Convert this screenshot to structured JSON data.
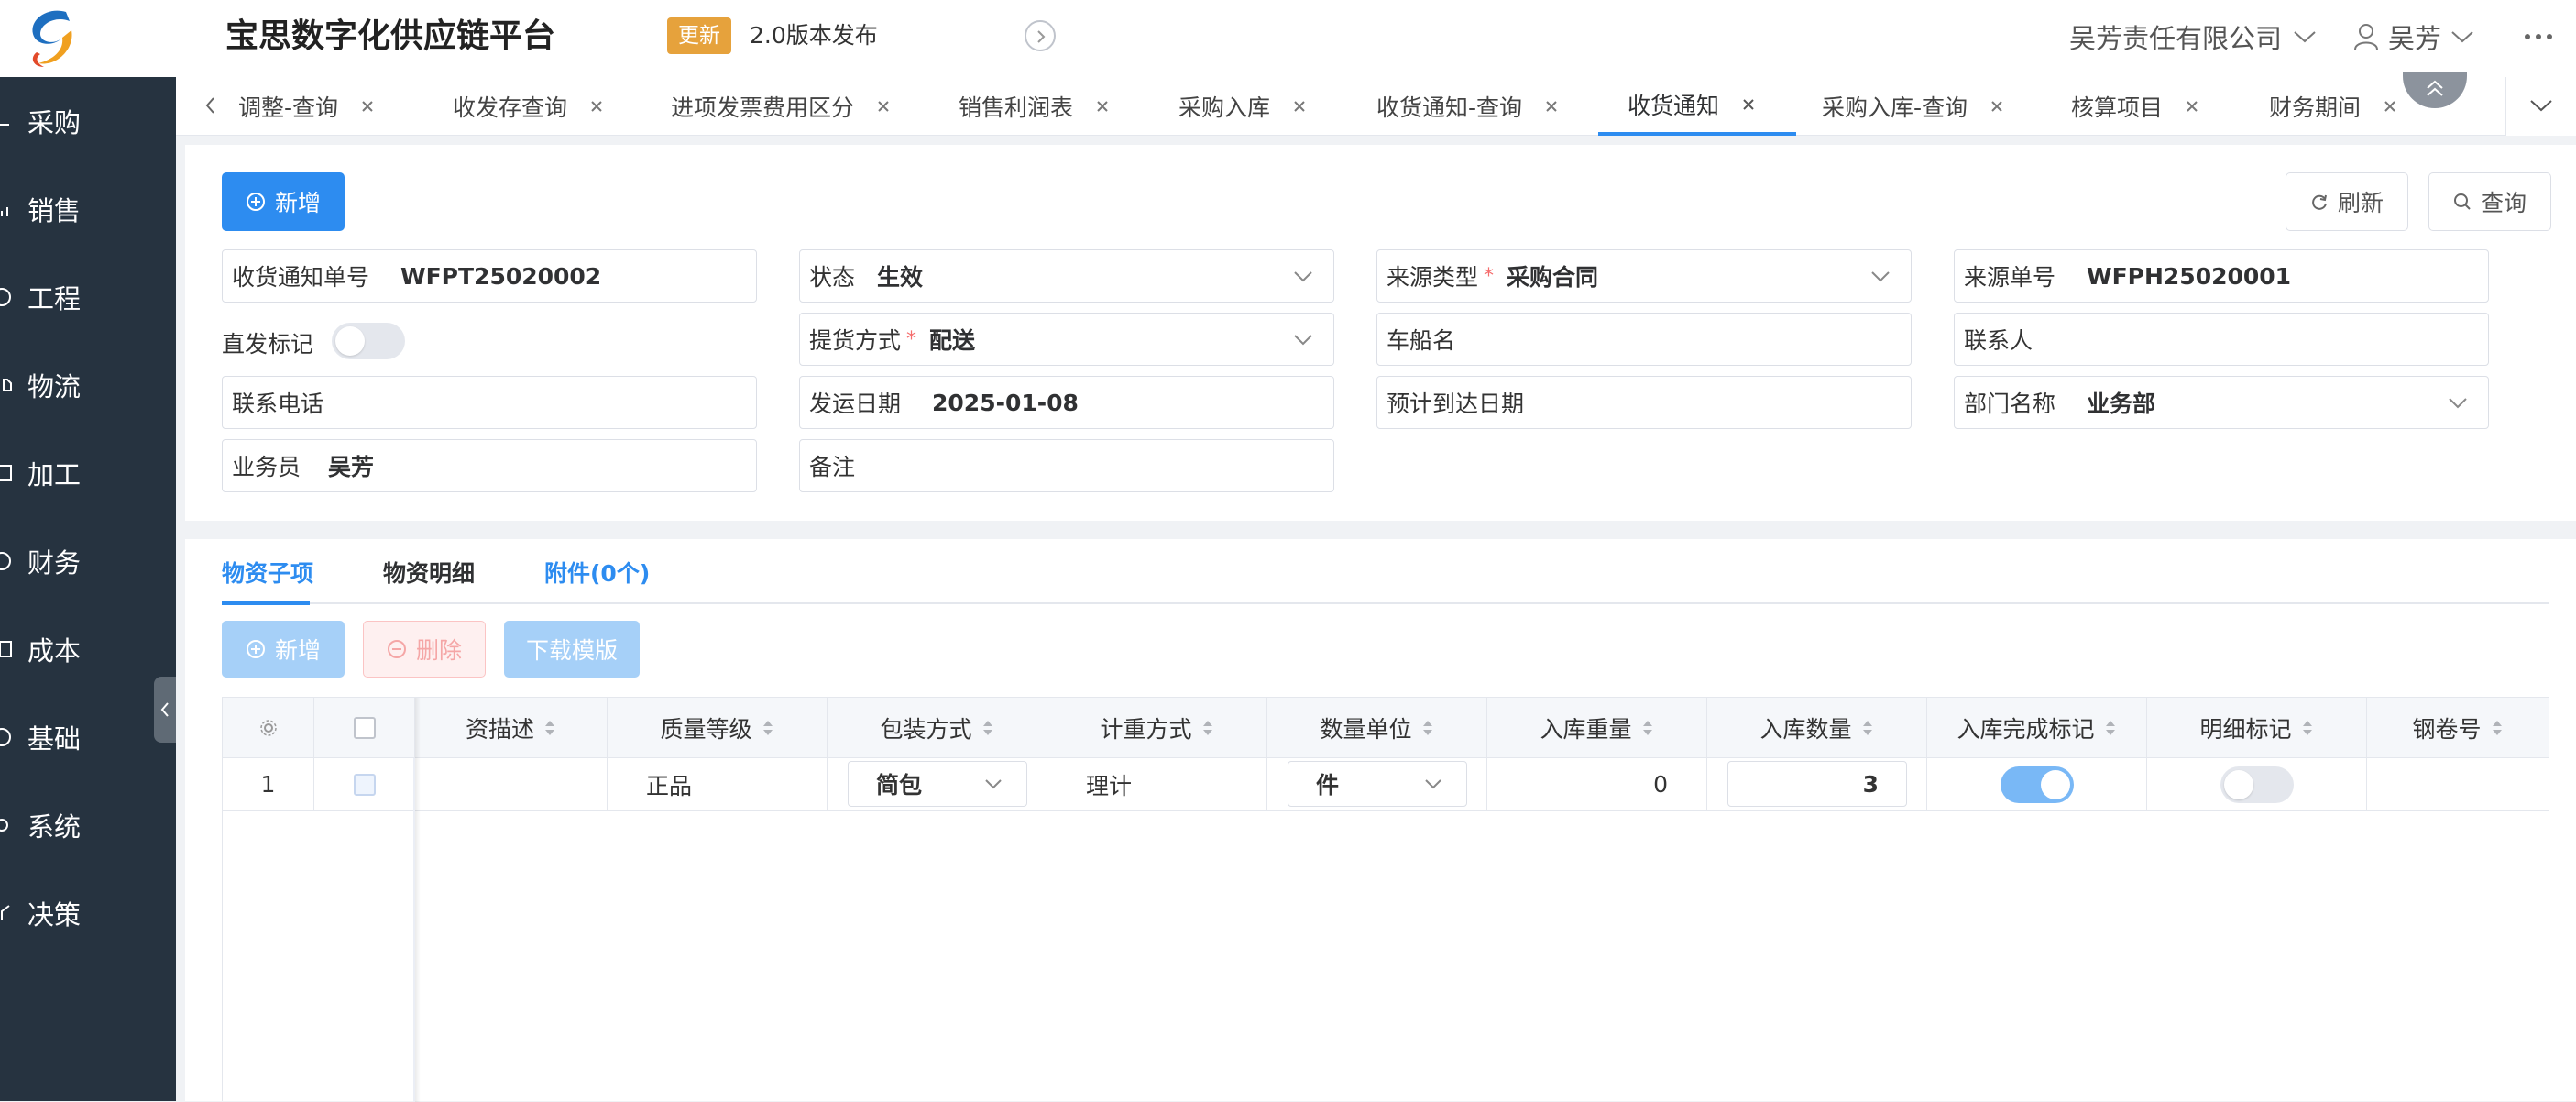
{
  "header": {
    "app_title": "宝思数字化供应链平台",
    "update_badge": "更新",
    "release_note": "2.0版本发布",
    "company": "吴芳责任有限公司",
    "user": "吴芳",
    "accent_color": "#2d8cf0",
    "badge_color": "#e6a23c"
  },
  "sidebar": {
    "items": [
      {
        "label": "采购",
        "icon": "cart-icon"
      },
      {
        "label": "销售",
        "icon": "chart-icon"
      },
      {
        "label": "工程",
        "icon": "circle-icon"
      },
      {
        "label": "物流",
        "icon": "truck-icon"
      },
      {
        "label": "加工",
        "icon": "box-icon"
      },
      {
        "label": "财务",
        "icon": "money-icon"
      },
      {
        "label": "成本",
        "icon": "calc-icon"
      },
      {
        "label": "基础",
        "icon": "base-icon"
      },
      {
        "label": "系统",
        "icon": "gear-icon"
      },
      {
        "label": "决策",
        "icon": "decision-icon"
      }
    ],
    "background": "#263340"
  },
  "tabs": [
    {
      "label": "调整-查询",
      "active": false
    },
    {
      "label": "收发存查询",
      "active": false
    },
    {
      "label": "进项发票费用区分",
      "active": false
    },
    {
      "label": "销售利润表",
      "active": false
    },
    {
      "label": "采购入库",
      "active": false
    },
    {
      "label": "收货通知-查询",
      "active": false
    },
    {
      "label": "收货通知",
      "active": true
    },
    {
      "label": "采购入库-查询",
      "active": false
    },
    {
      "label": "核算项目",
      "active": false
    },
    {
      "label": "财务期间",
      "active": false
    }
  ],
  "toolbar": {
    "add_label": "新增",
    "refresh_label": "刷新",
    "query_label": "查询"
  },
  "form": {
    "notice_no": {
      "label": "收货通知单号",
      "value": "WFPT25020002"
    },
    "status": {
      "label": "状态",
      "value": "生效"
    },
    "source_type": {
      "label": "来源类型",
      "required_mark": "*",
      "value": "采购合同"
    },
    "source_no": {
      "label": "来源单号",
      "value": "WFPH25020001"
    },
    "direct_flag": {
      "label": "直发标记",
      "on": false
    },
    "pickup_method": {
      "label": "提货方式",
      "required_mark": "*",
      "value": "配送"
    },
    "vessel_name": {
      "label": "车船名",
      "value": ""
    },
    "contact": {
      "label": "联系人",
      "value": ""
    },
    "phone": {
      "label": "联系电话",
      "value": ""
    },
    "ship_date": {
      "label": "发运日期",
      "value": "2025-01-08"
    },
    "eta": {
      "label": "预计到达日期",
      "value": ""
    },
    "department": {
      "label": "部门名称",
      "value": "业务部"
    },
    "salesperson": {
      "label": "业务员",
      "value": "吴芳"
    },
    "remark": {
      "label": "备注",
      "value": ""
    }
  },
  "detail": {
    "tabs": [
      {
        "label": "物资子项",
        "active": true
      },
      {
        "label": "物资明细",
        "active": false
      },
      {
        "label": "附件(0个)",
        "active": false
      }
    ],
    "buttons": {
      "add_label": "新增",
      "delete_label": "删除",
      "download_label": "下载模版"
    },
    "table": {
      "columns": [
        "资描述",
        "质量等级",
        "包装方式",
        "计重方式",
        "数量单位",
        "入库重量",
        "入库数量",
        "入库完成标记",
        "明细标记",
        "钢卷号"
      ],
      "rows": [
        {
          "index": "1",
          "desc": "",
          "quality": "正品",
          "packing": "简包",
          "weigh_method": "理计",
          "unit": "件",
          "weight": "0",
          "quantity": "3",
          "complete_flag": true,
          "detail_flag": false,
          "coil_no": ""
        }
      ]
    }
  }
}
